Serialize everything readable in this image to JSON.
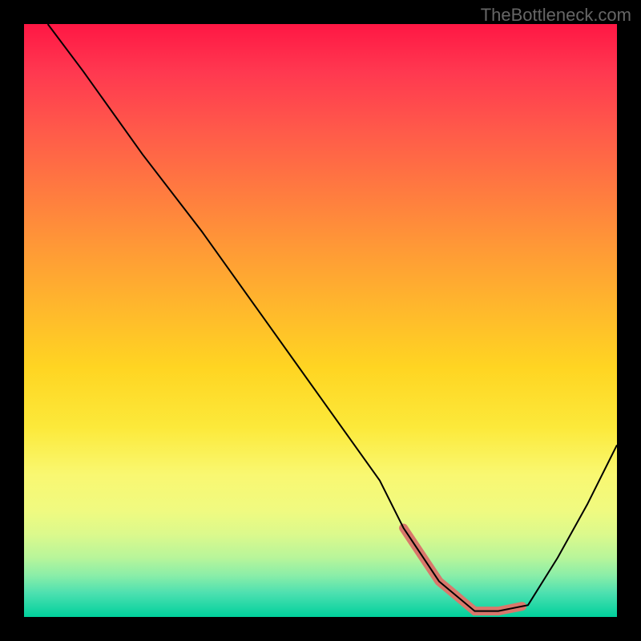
{
  "watermark": "TheBottleneck.com",
  "chart_data": {
    "type": "line",
    "title": "",
    "xlabel": "",
    "ylabel": "",
    "xlim": [
      0,
      100
    ],
    "ylim": [
      0,
      100
    ],
    "background": "vertical-gradient red→yellow→green",
    "series": [
      {
        "name": "curve",
        "x": [
          4,
          10,
          20,
          30,
          40,
          50,
          60,
          64,
          70,
          76,
          80,
          85,
          90,
          95,
          100
        ],
        "values": [
          100,
          92,
          78,
          65,
          51,
          37,
          23,
          15,
          6,
          1,
          1,
          2,
          10,
          19,
          29
        ]
      }
    ],
    "highlight_region": {
      "x_start": 64,
      "x_end": 84,
      "color": "#d9776b"
    }
  }
}
